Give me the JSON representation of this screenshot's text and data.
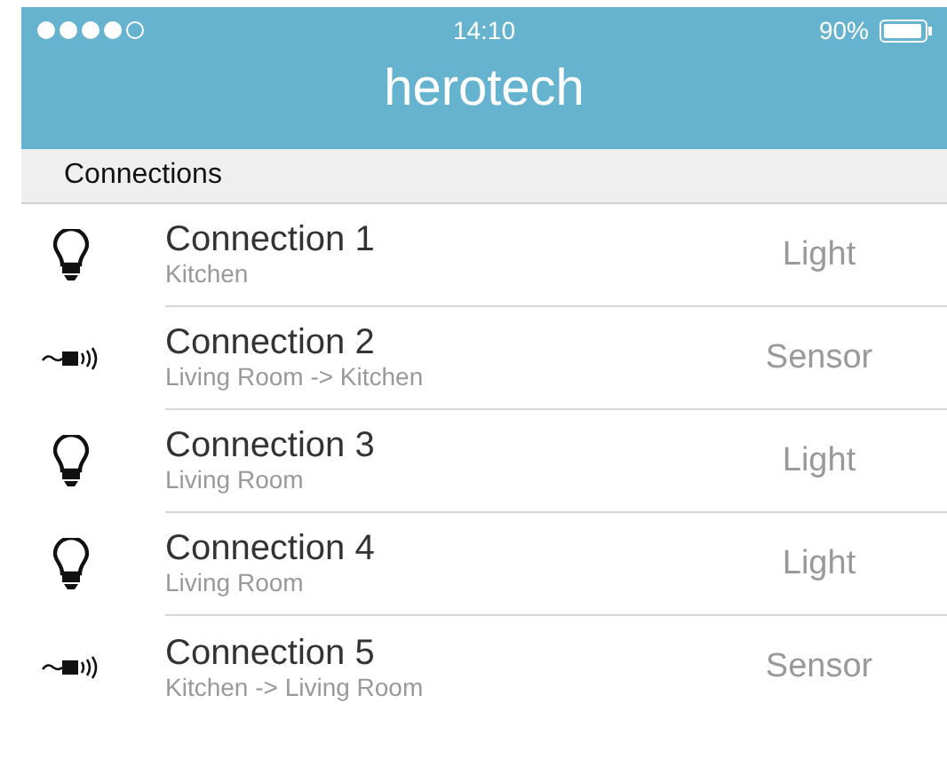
{
  "status_bar": {
    "time": "14:10",
    "battery": "90%"
  },
  "header": {
    "title": "herotech"
  },
  "section": {
    "title": "Connections"
  },
  "connections": [
    {
      "kind": "light",
      "name": "Connection 1",
      "route": "Kitchen",
      "type": "Light"
    },
    {
      "kind": "sensor",
      "name": "Connection 2",
      "route": "Living Room -> Kitchen",
      "type": "Sensor"
    },
    {
      "kind": "light",
      "name": "Connection 3",
      "route": "Living Room",
      "type": "Light"
    },
    {
      "kind": "light",
      "name": "Connection 4",
      "route": "Living Room",
      "type": "Light"
    },
    {
      "kind": "sensor",
      "name": "Connection 5",
      "route": "Kitchen -> Living Room",
      "type": "Sensor"
    }
  ]
}
